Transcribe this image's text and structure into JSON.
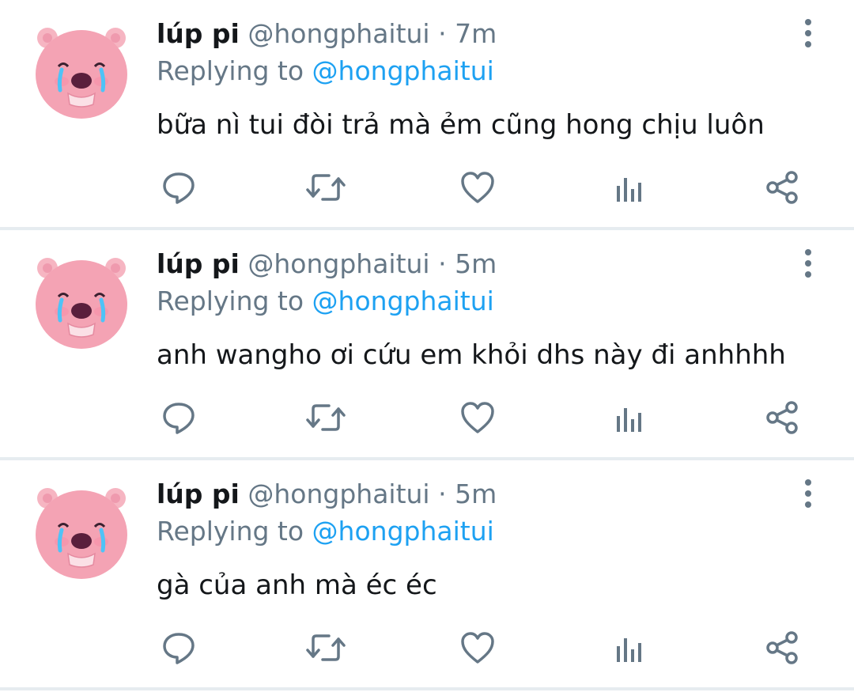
{
  "tweets": [
    {
      "name": "lúp pi",
      "handle": "@hongphaitui",
      "separator": "·",
      "time": "7m",
      "replying_prefix": "Replying to",
      "replying_to": "@hongphaitui",
      "text": "bữa nì tui đòi trả mà ẻm cũng hong chịu luôn"
    },
    {
      "name": "lúp pi",
      "handle": "@hongphaitui",
      "separator": "·",
      "time": "5m",
      "replying_prefix": "Replying to",
      "replying_to": "@hongphaitui",
      "text": "anh wangho ơi cứu em khỏi dhs này đi anhhhh"
    },
    {
      "name": "lúp pi",
      "handle": "@hongphaitui",
      "separator": "·",
      "time": "5m",
      "replying_prefix": "Replying to",
      "replying_to": "@hongphaitui",
      "text": "gà của anh mà éc éc"
    }
  ],
  "icons": {
    "avatar": "loopy-crying-bear-avatar",
    "more": "vertical-dots-icon",
    "reply": "reply-bubble-icon",
    "retweet": "retweet-icon",
    "like": "heart-icon",
    "stats": "stats-bars-icon",
    "share": "share-icon"
  },
  "colors": {
    "text_primary": "#14171a",
    "text_secondary": "#657786",
    "accent": "#1da1f2",
    "divider": "#e6ecf0",
    "icon": "#657786",
    "avatar_pink": "#f4a3b4"
  }
}
